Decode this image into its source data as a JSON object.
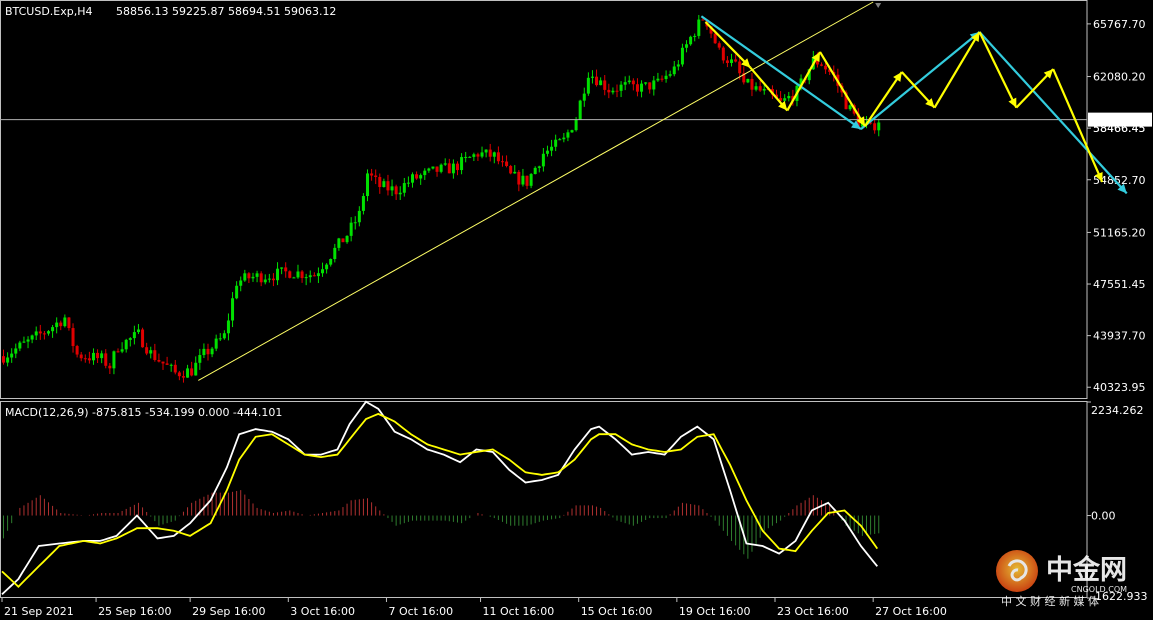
{
  "header": {
    "symbol_info": "BTCUSD.Exp,H4",
    "ohlc": "58856.13 59225.87 58694.51 59063.12"
  },
  "macd": {
    "info": "MACD(12,26,9) -875.815 -534.199 0.000 -444.101"
  },
  "watermark": {
    "brand": "中金网",
    "domain": "CNGOLD.COM",
    "tagline": "中 文 财 经 新 媒 体"
  },
  "colors": {
    "bull": "#00e000",
    "bear": "#e00000",
    "trendline": "#ffff66",
    "arrow_yellow": "#ffff00",
    "arrow_cyan": "#33ccdd",
    "macd_line": "#ffffff",
    "signal_line": "#ffff00",
    "hist_pos": "#b03030",
    "hist_neg": "#2e7d2e"
  },
  "chart_data": [
    {
      "type": "candlestick",
      "title": "BTCUSD.Exp,H4",
      "current_price": "59063.12",
      "overlapped_label": "58466.45",
      "y_ticks": [
        "65767.70",
        "62080.20",
        "58466.45",
        "54852.70",
        "51165.20",
        "47551.45",
        "43937.70",
        "40323.95"
      ],
      "y_tick_values": [
        65767.7,
        62080.2,
        58466.45,
        54852.7,
        51165.2,
        47551.45,
        43937.7,
        40323.95
      ],
      "ylim": [
        39500,
        67300
      ],
      "x_ticks": [
        "21 Sep 2021",
        "25 Sep 16:00",
        "29 Sep 16:00",
        "3 Oct 16:00",
        "7 Oct 16:00",
        "11 Oct 16:00",
        "15 Oct 16:00",
        "19 Oct 16:00",
        "23 Oct 16:00",
        "27 Oct 16:00"
      ],
      "x_tick_bar_index": [
        0,
        23,
        46,
        70,
        94,
        117,
        141,
        165,
        189,
        213
      ],
      "total_slots": 270,
      "close_path": [
        [
          0,
          42500
        ],
        [
          6,
          43500
        ],
        [
          10,
          44200
        ],
        [
          15,
          45200
        ],
        [
          16,
          44100
        ],
        [
          18,
          42600
        ],
        [
          24,
          42300
        ],
        [
          26,
          41800
        ],
        [
          28,
          43200
        ],
        [
          33,
          44000
        ],
        [
          36,
          42700
        ],
        [
          42,
          41300
        ],
        [
          46,
          41500
        ],
        [
          49,
          42600
        ],
        [
          54,
          43900
        ],
        [
          57,
          47700
        ],
        [
          60,
          48000
        ],
        [
          66,
          48200
        ],
        [
          70,
          48400
        ],
        [
          76,
          48200
        ],
        [
          80,
          49600
        ],
        [
          84,
          51000
        ],
        [
          87,
          52400
        ],
        [
          89,
          55300
        ],
        [
          92,
          54400
        ],
        [
          96,
          54100
        ],
        [
          100,
          54900
        ],
        [
          106,
          55500
        ],
        [
          110,
          55700
        ],
        [
          116,
          56700
        ],
        [
          120,
          56500
        ],
        [
          124,
          55100
        ],
        [
          128,
          54700
        ],
        [
          132,
          56700
        ],
        [
          137,
          57600
        ],
        [
          140,
          59200
        ],
        [
          143,
          62400
        ],
        [
          148,
          61200
        ],
        [
          152,
          61400
        ],
        [
          156,
          61300
        ],
        [
          160,
          61600
        ],
        [
          164,
          62600
        ],
        [
          168,
          64800
        ],
        [
          171,
          66200
        ],
        [
          172,
          65900
        ],
        [
          175,
          63800
        ],
        [
          179,
          62800
        ],
        [
          181,
          61600
        ],
        [
          184,
          61200
        ],
        [
          187,
          60800
        ],
        [
          190,
          60200
        ],
        [
          194,
          61000
        ],
        [
          198,
          63200
        ],
        [
          200,
          63000
        ],
        [
          203,
          62100
        ],
        [
          206,
          60200
        ],
        [
          209,
          58900
        ],
        [
          212,
          58400
        ],
        [
          214,
          59063
        ]
      ],
      "annotations": {
        "trendline": [
          [
            48,
            40800
          ],
          [
            213,
            67300
          ]
        ],
        "yellow_path": [
          [
            172,
            65900
          ],
          [
            183,
            62700
          ],
          [
            192,
            59700
          ],
          [
            200,
            63800
          ],
          [
            211,
            58600
          ],
          [
            220,
            62400
          ],
          [
            228,
            59900
          ],
          [
            239,
            65200
          ],
          [
            248,
            59900
          ],
          [
            257,
            62600
          ],
          [
            269,
            54700
          ]
        ],
        "cyan_path": [
          [
            171,
            66300
          ],
          [
            210,
            58400
          ],
          [
            239,
            65200
          ],
          [
            275,
            53900
          ]
        ]
      }
    },
    {
      "type": "macd",
      "title": "MACD(12,26,9) -875.815 -534.199 0.000 -444.101",
      "parameters": [
        12,
        26,
        9
      ],
      "values": {
        "macd": -875.815,
        "signal": -534.199,
        "level": 0.0,
        "histogram": -444.101
      },
      "y_ticks": [
        "2234.262",
        "0.00",
        "-1622.933"
      ],
      "y_tick_values": [
        2234.262,
        0.0,
        -1622.933
      ],
      "ylim": [
        -1622.933,
        2234.262
      ],
      "macd_path": [
        [
          0,
          -1550
        ],
        [
          4,
          -1250
        ],
        [
          9,
          -600
        ],
        [
          14,
          -550
        ],
        [
          20,
          -500
        ],
        [
          24,
          -500
        ],
        [
          28,
          -400
        ],
        [
          33,
          0
        ],
        [
          38,
          -450
        ],
        [
          42,
          -400
        ],
        [
          46,
          -150
        ],
        [
          51,
          300
        ],
        [
          55,
          950
        ],
        [
          58,
          1600
        ],
        [
          62,
          1700
        ],
        [
          66,
          1650
        ],
        [
          70,
          1500
        ],
        [
          74,
          1200
        ],
        [
          78,
          1200
        ],
        [
          82,
          1300
        ],
        [
          85,
          1800
        ],
        [
          89,
          2240
        ],
        [
          92,
          2100
        ],
        [
          96,
          1650
        ],
        [
          100,
          1500
        ],
        [
          104,
          1300
        ],
        [
          108,
          1200
        ],
        [
          112,
          1050
        ],
        [
          116,
          1300
        ],
        [
          120,
          1250
        ],
        [
          124,
          900
        ],
        [
          128,
          650
        ],
        [
          132,
          700
        ],
        [
          136,
          800
        ],
        [
          140,
          1300
        ],
        [
          144,
          1700
        ],
        [
          146,
          1750
        ],
        [
          150,
          1500
        ],
        [
          154,
          1200
        ],
        [
          158,
          1250
        ],
        [
          162,
          1200
        ],
        [
          166,
          1550
        ],
        [
          170,
          1750
        ],
        [
          174,
          1500
        ],
        [
          178,
          500
        ],
        [
          182,
          -550
        ],
        [
          186,
          -600
        ],
        [
          190,
          -750
        ],
        [
          194,
          -500
        ],
        [
          198,
          100
        ],
        [
          202,
          250
        ],
        [
          206,
          -100
        ],
        [
          210,
          -600
        ],
        [
          214,
          -1000
        ]
      ],
      "signal_path": [
        [
          0,
          -1100
        ],
        [
          4,
          -1400
        ],
        [
          9,
          -1000
        ],
        [
          14,
          -600
        ],
        [
          20,
          -500
        ],
        [
          24,
          -550
        ],
        [
          28,
          -450
        ],
        [
          33,
          -250
        ],
        [
          38,
          -250
        ],
        [
          42,
          -300
        ],
        [
          46,
          -400
        ],
        [
          51,
          -150
        ],
        [
          55,
          500
        ],
        [
          58,
          1100
        ],
        [
          62,
          1550
        ],
        [
          66,
          1600
        ],
        [
          70,
          1400
        ],
        [
          74,
          1200
        ],
        [
          78,
          1150
        ],
        [
          82,
          1200
        ],
        [
          85,
          1500
        ],
        [
          89,
          1900
        ],
        [
          92,
          2000
        ],
        [
          96,
          1850
        ],
        [
          100,
          1600
        ],
        [
          104,
          1400
        ],
        [
          108,
          1300
        ],
        [
          112,
          1200
        ],
        [
          116,
          1250
        ],
        [
          120,
          1300
        ],
        [
          124,
          1100
        ],
        [
          128,
          850
        ],
        [
          132,
          800
        ],
        [
          136,
          850
        ],
        [
          140,
          1100
        ],
        [
          144,
          1500
        ],
        [
          146,
          1600
        ],
        [
          150,
          1600
        ],
        [
          154,
          1400
        ],
        [
          158,
          1300
        ],
        [
          162,
          1250
        ],
        [
          166,
          1300
        ],
        [
          170,
          1550
        ],
        [
          174,
          1600
        ],
        [
          178,
          1000
        ],
        [
          182,
          300
        ],
        [
          186,
          -300
        ],
        [
          190,
          -650
        ],
        [
          194,
          -700
        ],
        [
          198,
          -300
        ],
        [
          202,
          50
        ],
        [
          206,
          100
        ],
        [
          210,
          -200
        ],
        [
          214,
          -650
        ]
      ]
    }
  ]
}
